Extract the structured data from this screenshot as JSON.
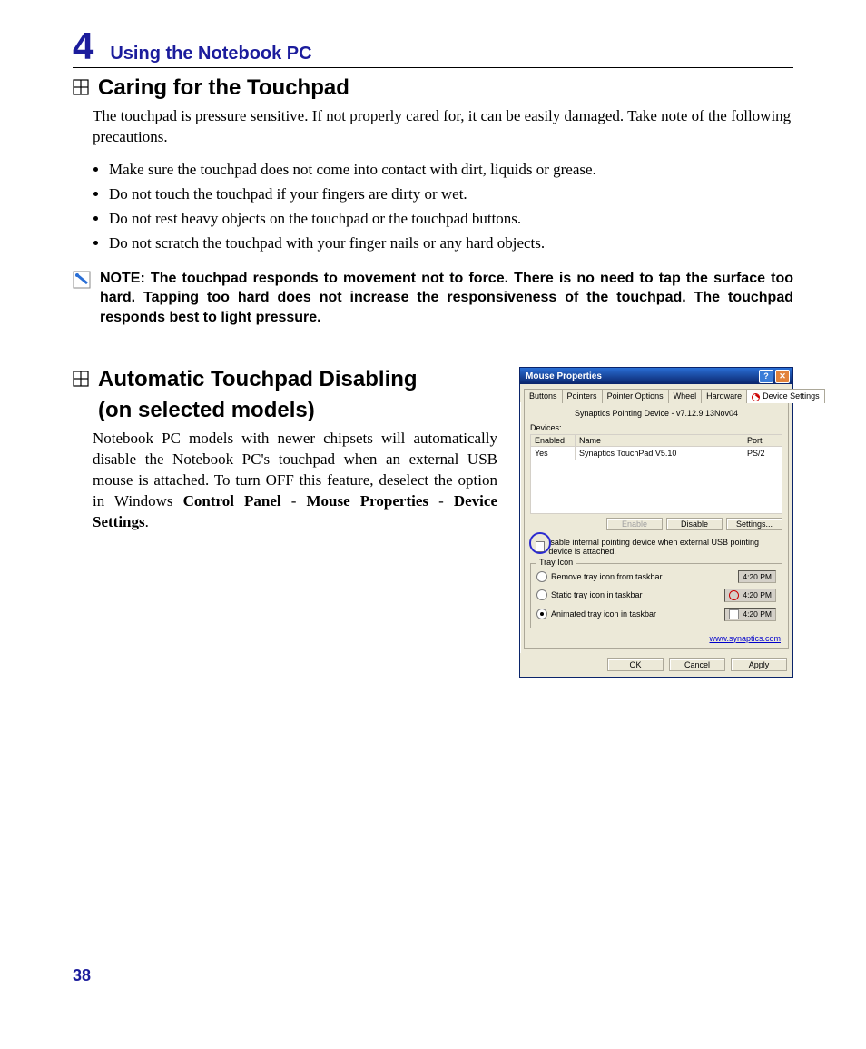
{
  "chapter": {
    "number": "4",
    "title": "Using the Notebook PC"
  },
  "section1": {
    "title": "Caring for the Touchpad",
    "intro": "The touchpad is pressure sensitive. If not properly cared for, it can be easily damaged. Take note of the following precautions.",
    "bullets": [
      "Make sure the touchpad does not come into contact with dirt, liquids or grease.",
      "Do not touch the touchpad if your fingers are dirty or wet.",
      "Do not rest heavy objects on the touchpad or the touchpad buttons.",
      "Do not scratch the touchpad with your finger nails or any hard objects."
    ]
  },
  "note": {
    "label": "NOTE:  ",
    "text": "The touchpad responds to movement not to force. There is no need to tap the surface too hard. Tapping too hard does not increase the responsiveness of the touchpad. The touchpad responds best to light pressure."
  },
  "section2": {
    "title_line1": "Automatic Touchpad Disabling",
    "title_line2": "(on selected models)",
    "body_plain": "Notebook PC models with newer chipsets will automatically disable the Notebook PC's touchpad when an external USB mouse is attached. To turn OFF this feature, deselect the option in Windows ",
    "bold1": "Control Panel",
    "sep1": " - ",
    "bold2": "Mouse Properties",
    "sep2": " - ",
    "bold3": "Device Settings",
    "tail": "."
  },
  "dialog": {
    "title": "Mouse Properties",
    "tabs": [
      "Buttons",
      "Pointers",
      "Pointer Options",
      "Wheel",
      "Hardware",
      "Device Settings"
    ],
    "driver": "Synaptics Pointing Device - v7.12.9 13Nov04",
    "devices_label": "Devices:",
    "table": {
      "headers": [
        "Enabled",
        "Name",
        "Port"
      ],
      "row": {
        "enabled": "Yes",
        "name": "Synaptics TouchPad V5.10",
        "port": "PS/2"
      }
    },
    "buttons_row": {
      "enable": "Enable",
      "disable": "Disable",
      "settings": "Settings..."
    },
    "checkbox_label": "isable internal pointing device when external USB pointing device is attached.",
    "tray_legend": "Tray Icon",
    "tray": {
      "opt1": "Remove tray icon from taskbar",
      "opt2": "Static tray icon in taskbar",
      "opt3": "Animated tray icon in taskbar",
      "time": "4:20 PM"
    },
    "link": "www.synaptics.com",
    "footer": {
      "ok": "OK",
      "cancel": "Cancel",
      "apply": "Apply"
    }
  },
  "page_number": "38"
}
